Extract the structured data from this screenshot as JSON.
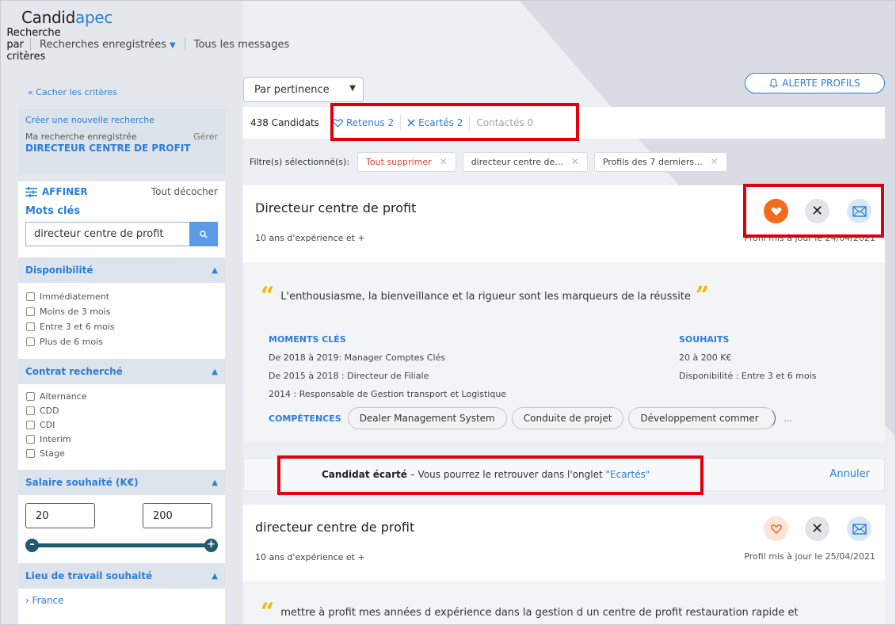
{
  "brand": {
    "part1": "Candid",
    "part2": "apec"
  },
  "topnav": {
    "criteria": "Recherche par critères",
    "saved": "Recherches enregistrées",
    "messages": "Tous les messages"
  },
  "left": {
    "hide_criteria": "« Cacher les critères",
    "new_search": "Créer une nouvelle recherche",
    "saved_label": "Ma recherche enregistrée",
    "manage": "Gérer",
    "saved_name": "DIRECTEUR CENTRE DE PROFIT",
    "refine_title": "AFFINER",
    "uncheck_all": "Tout décocher",
    "keywords_label": "Mots clés",
    "keywords_value": "directeur centre de profit",
    "availability": {
      "title": "Disponibilité",
      "options": [
        "Immédiatement",
        "Moins de 3 mois",
        "Entre 3 et 6 mois",
        "Plus de 6 mois"
      ]
    },
    "contract": {
      "title": "Contrat recherché",
      "options": [
        "Alternance",
        "CDD",
        "CDI",
        "Interim",
        "Stage"
      ]
    },
    "salary": {
      "title": "Salaire souhaité (K€)",
      "min": "20",
      "max": "200"
    },
    "location": {
      "title": "Lieu de travail souhaité",
      "item": "France"
    }
  },
  "main": {
    "sort": "Par pertinence",
    "alert": "ALERTE PROFILS",
    "tabs": {
      "candidates": "438 Candidats",
      "retained": "Retenus 2",
      "rejected": "Ecartés 2",
      "contacted": "Contactés 0"
    },
    "filters_label": "Filtre(s) sélectionné(s):",
    "filter_chips": [
      "Tout supprimer",
      "directeur centre de...",
      "Profils des 7 derniers..."
    ],
    "card1": {
      "title": "Directeur centre de profit",
      "experience": "10 ans d'expérience et +",
      "updated": "Profil mis à jour le 24/04/2021",
      "quote": "L'enthousiasme, la bienveillance et la rigueur sont les marqueurs de la réussite",
      "moments_title": "MOMENTS CLÉS",
      "moments": [
        "De 2018 à 2019: Manager Comptes Clés",
        "De 2015 à 2018 : Directeur de Filiale",
        "2014 : Responsable de Gestion transport et Logistique"
      ],
      "wishes_title": "SOUHAITS",
      "wishes": [
        "20 à 200 K€",
        "Disponibilité : Entre 3 et 6 mois"
      ],
      "skills_label": "COMPÉTENCES",
      "skills": [
        "Dealer Management System",
        "Conduite de projet",
        "Développement commer"
      ],
      "more": "..."
    },
    "reject_notice": {
      "bold": "Candidat écarté",
      "text": " – Vous pourrez le retrouver dans l'onglet ",
      "link": "\"Ecartés\"",
      "undo": "Annuler"
    },
    "card2": {
      "title": "directeur centre de profit",
      "experience": "10 ans d'expérience et +",
      "updated": "Profil mis à jour le 25/04/2021",
      "quote": "mettre à profit mes années d expérience dans la gestion d un centre de profit restauration rapide et"
    }
  },
  "colors": {
    "accent": "#2e7dd6",
    "like": "#f26b1d",
    "highlight": "#e0000d",
    "slider": "#1f5b70"
  }
}
